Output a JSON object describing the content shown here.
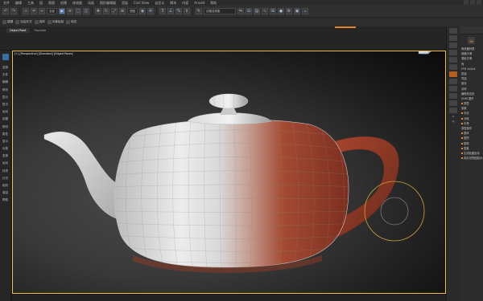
{
  "menu": [
    "文件",
    "编辑",
    "工具",
    "组",
    "视图",
    "创建",
    "修改器",
    "动画",
    "图形编辑器",
    "渲染",
    "Civil View",
    "自定义",
    "脚本",
    "内容",
    "Arnold",
    "帮助"
  ],
  "toolbar": {
    "filter_value": "全部",
    "view_value": "视图",
    "selection_set_placeholder": "创建选择集"
  },
  "ribbon": [
    "建模",
    "自由形式",
    "选择",
    "对象绘制",
    "填充"
  ],
  "tabs": [
    "Object Paint",
    "Populate"
  ],
  "viewport": {
    "label_parts": [
      "[+]",
      "[Perspective]",
      "[Standard]",
      "[Edged Faces]"
    ]
  },
  "left_panel": [
    "选择",
    "文件",
    "编辑",
    "修改",
    "显示",
    "层次",
    "运动",
    "创建",
    "修改",
    "属性",
    "显示",
    "对象",
    "变换",
    "运动",
    "材质",
    "灯光",
    "相机",
    "渲染",
    "帮助"
  ],
  "right_strip": [
    "⌂",
    "◎"
  ],
  "command_panel": {
    "rows": [
      "修改器列表",
      "网格平滑",
      "涡轮平滑",
      "壳",
      "FFD 4x4x4",
      "扭曲",
      "弯曲",
      "锥化",
      "对称",
      "编辑多边形",
      "UVW 展开",
      "茶壶",
      "参数",
      "半径",
      "分段",
      "平滑",
      "茶壶部件",
      "壶体",
      "壶把",
      "壶嘴",
      "壶盖",
      "生成贴图坐标",
      "真实世界贴图大小"
    ]
  },
  "colors": {
    "accent": "#e3862a",
    "viewport_border": "#f0c040",
    "teapot_red": "#a1442e",
    "teapot_white": "#e7e7e7"
  }
}
